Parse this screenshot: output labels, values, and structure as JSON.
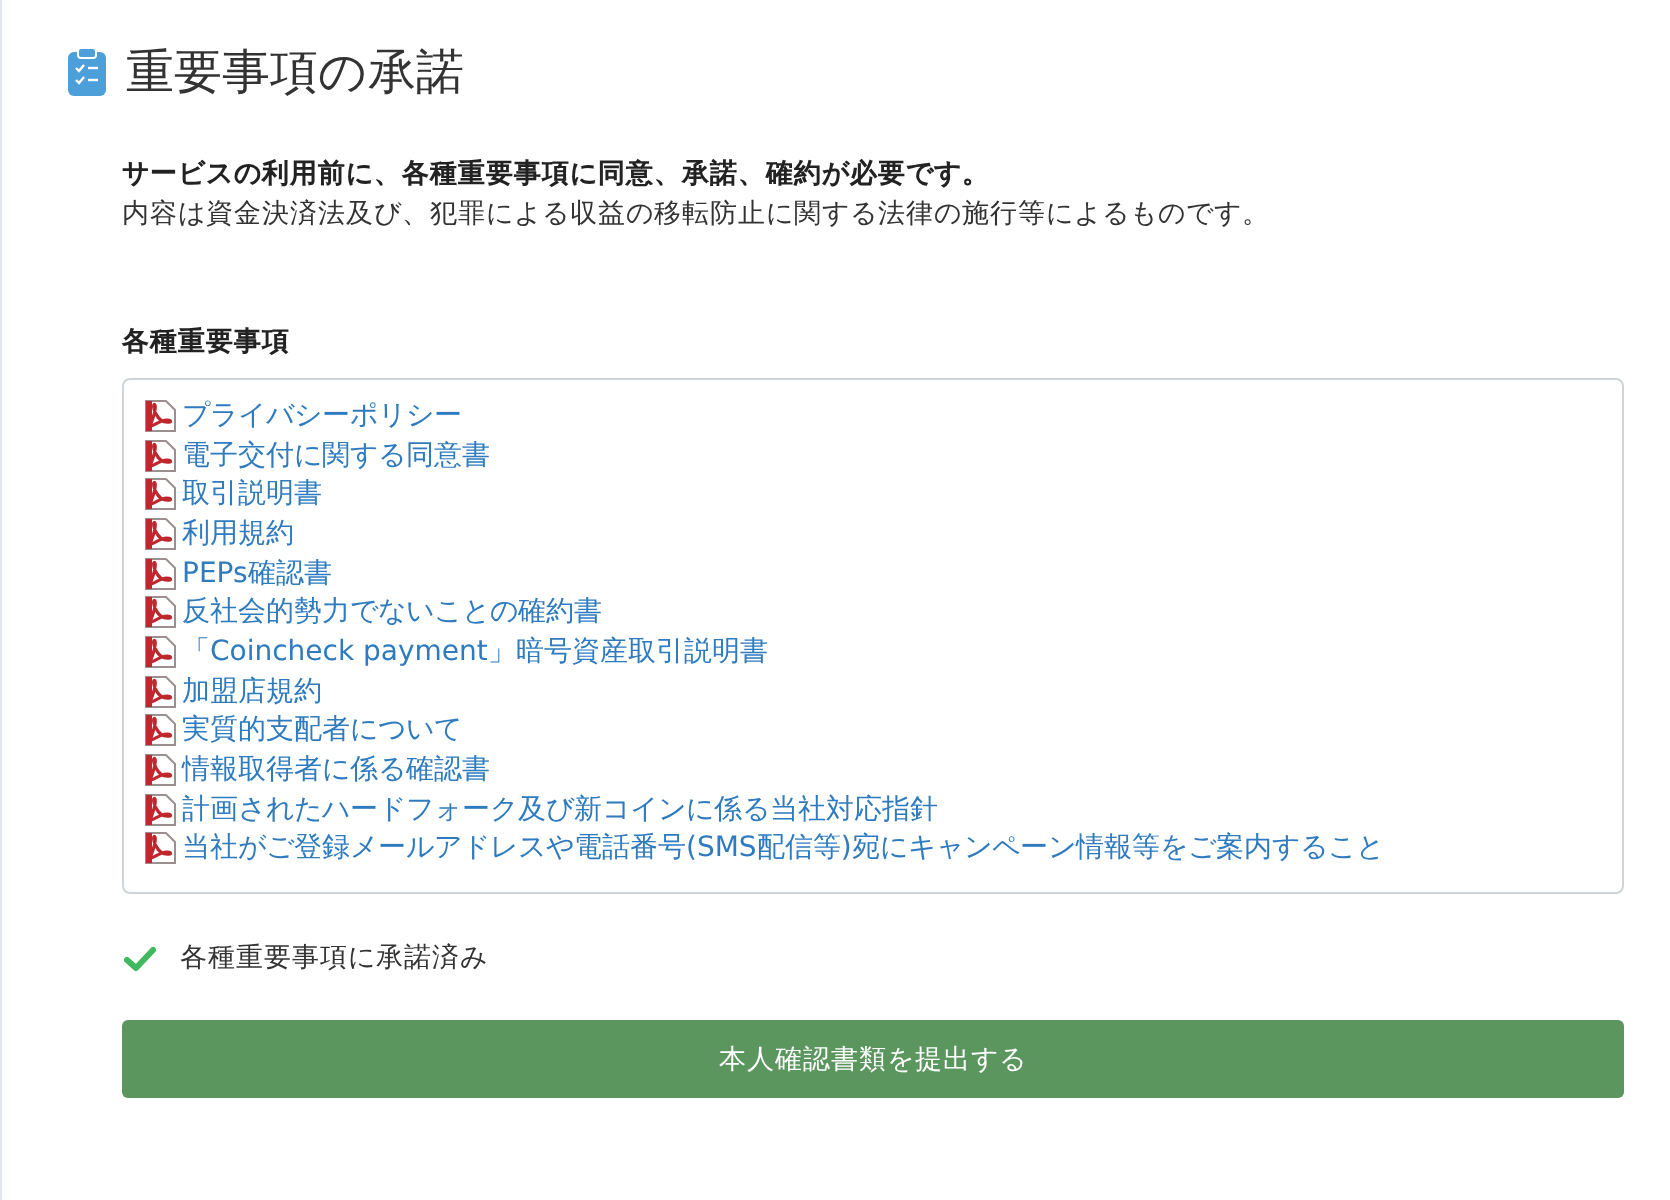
{
  "header": {
    "title": "重要事項の承諾"
  },
  "intro": {
    "lead": "サービスの利用前に、各種重要事項に同意、承諾、確約が必要です。",
    "note": "内容は資金決済法及び、犯罪による収益の移転防止に関する法律の施行等によるものです。"
  },
  "documents": {
    "label": "各種重要事項",
    "items": [
      "プライバシーポリシー",
      "電子交付に関する同意書",
      "取引説明書",
      "利用規約",
      "PEPs確認書",
      "反社会的勢力でないことの確約書",
      "「Coincheck payment」暗号資産取引説明書",
      "加盟店規約",
      "実質的支配者について",
      "情報取得者に係る確認書",
      "計画されたハードフォーク及び新コインに係る当社対応指針",
      "当社がご登録メールアドレスや電話番号(SMS配信等)宛にキャンペーン情報等をご案内すること"
    ]
  },
  "consent": {
    "checked": true,
    "label": "各種重要事項に承諾済み"
  },
  "submit_button": {
    "label": "本人確認書類を提出する"
  }
}
